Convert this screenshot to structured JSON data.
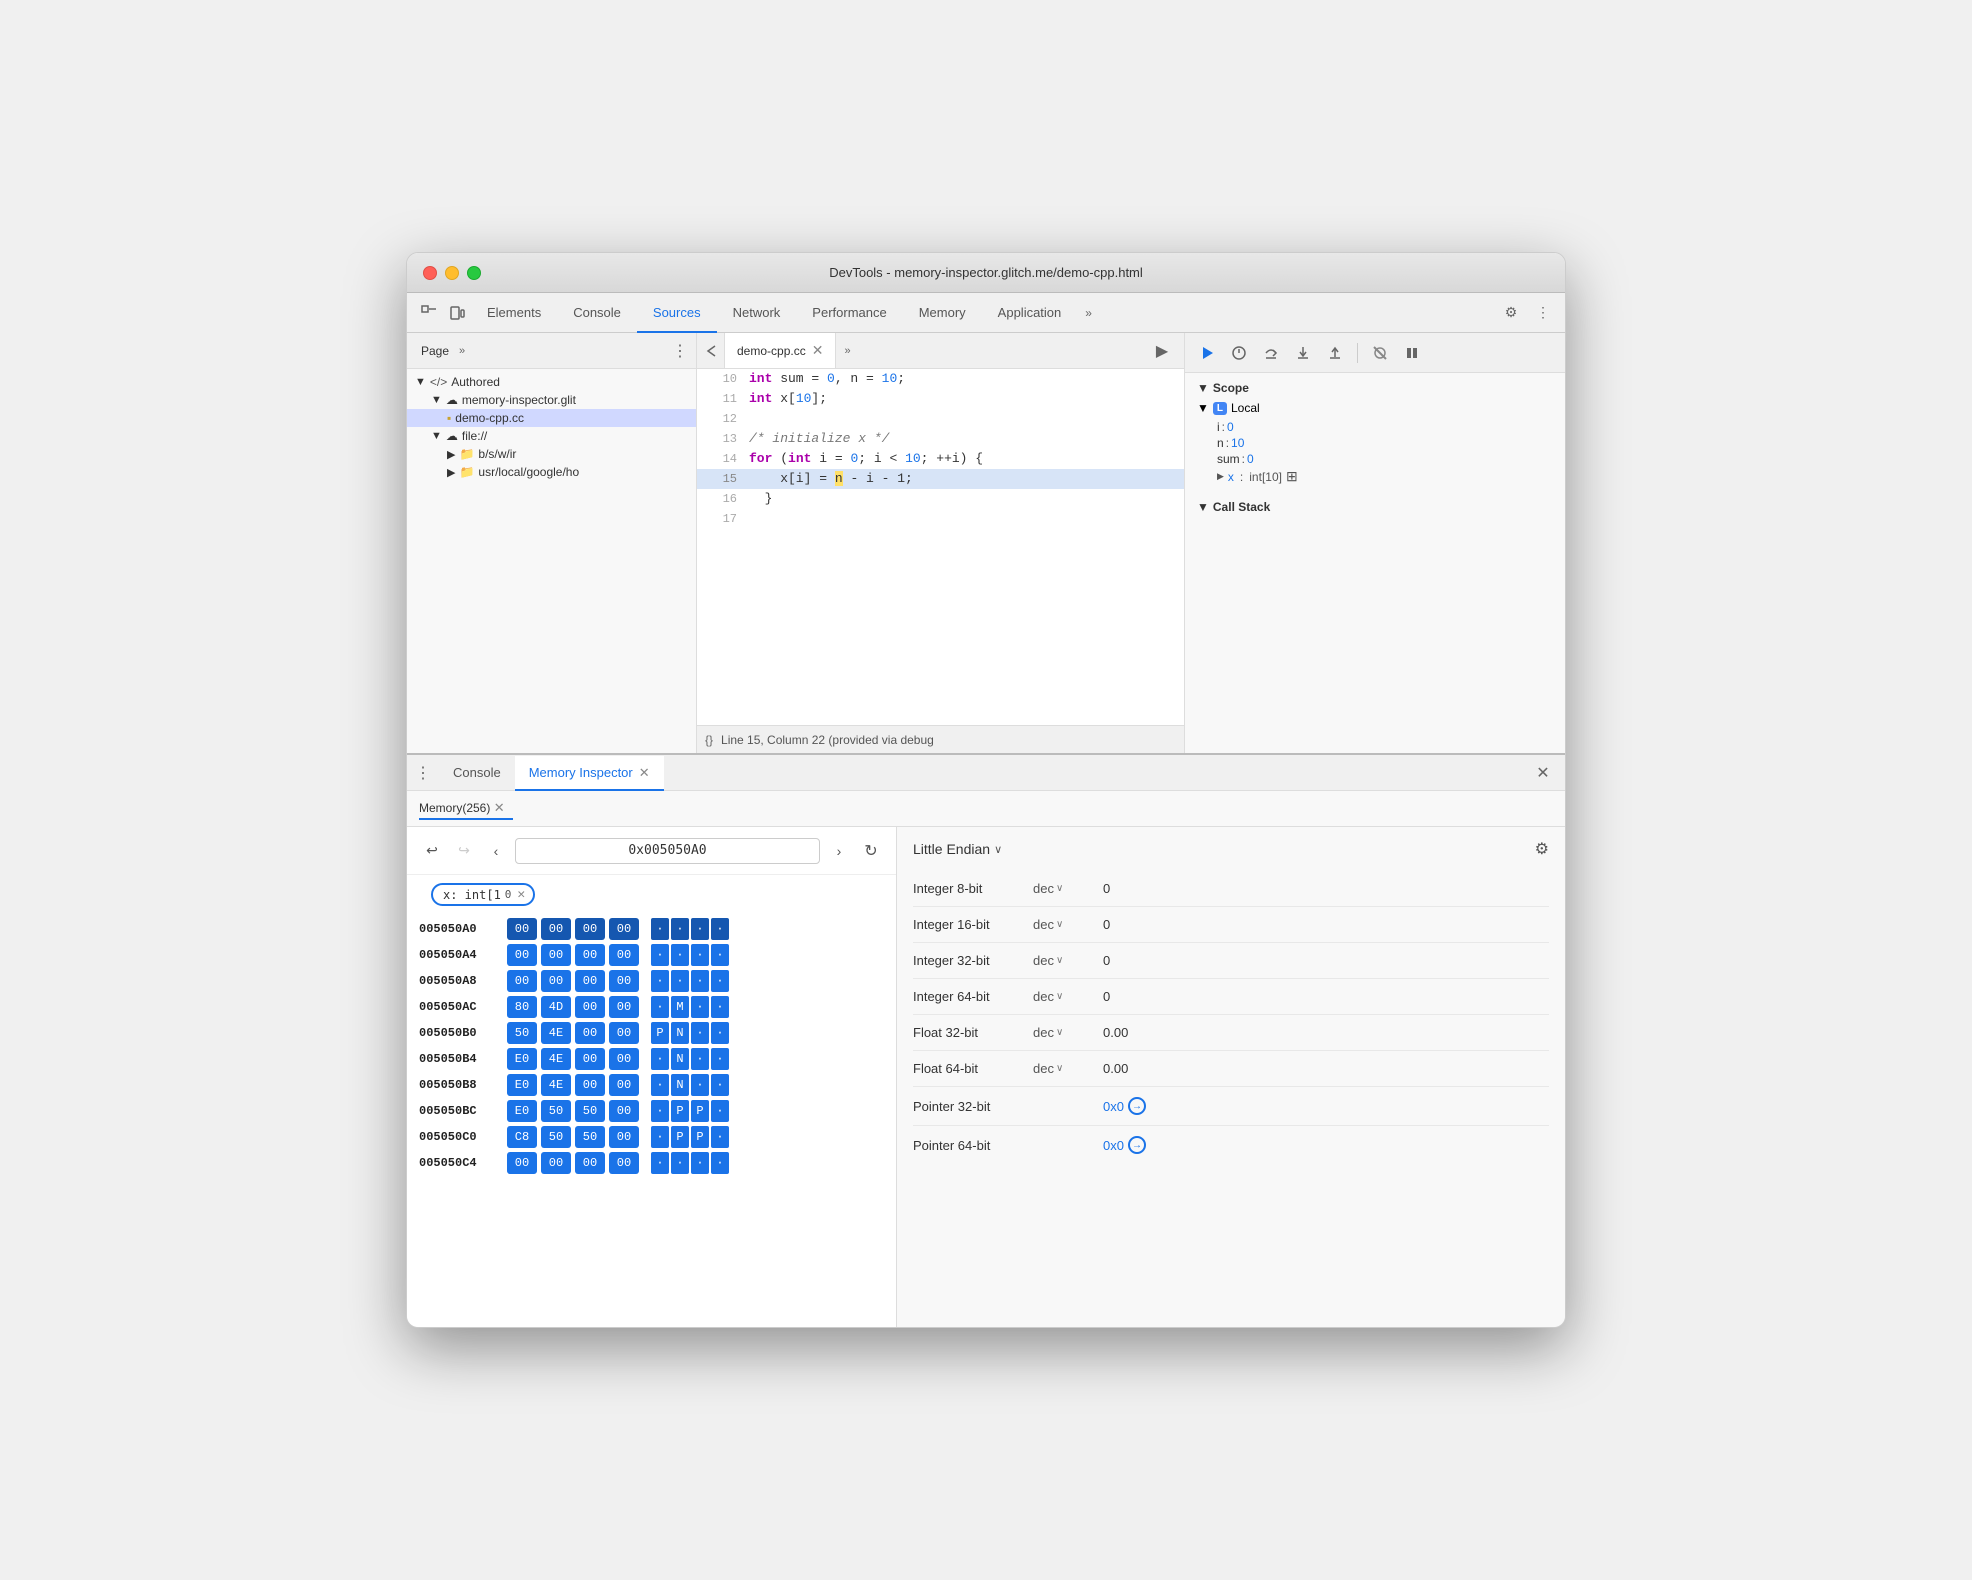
{
  "window": {
    "title": "DevTools - memory-inspector.glitch.me/demo-cpp.html"
  },
  "tabs": {
    "elements": "Elements",
    "console": "Console",
    "sources": "Sources",
    "network": "Network",
    "performance": "Performance",
    "memory": "Memory",
    "application": "Application",
    "more": "»"
  },
  "left_panel": {
    "tab": "Page",
    "more": "»",
    "tree": [
      {
        "label": "</> Authored",
        "indent": 0,
        "icon": "▶"
      },
      {
        "label": "memory-inspector.glit",
        "indent": 1,
        "icon": "☁",
        "expanded": true
      },
      {
        "label": "demo-cpp.cc",
        "indent": 2,
        "icon": "📄",
        "selected": true
      },
      {
        "label": "file://",
        "indent": 1,
        "icon": "☁",
        "expanded": true
      },
      {
        "label": "b/s/w/ir",
        "indent": 2,
        "icon": "📁",
        "has_arrow": true
      },
      {
        "label": "usr/local/google/ho",
        "indent": 2,
        "icon": "📁",
        "has_arrow": true
      }
    ]
  },
  "editor": {
    "tab_name": "demo-cpp.cc",
    "lines": [
      {
        "num": 10,
        "tokens": [
          {
            "type": "kw",
            "text": "int"
          },
          {
            "type": "normal",
            "text": " sum = "
          },
          {
            "type": "num",
            "text": "0"
          },
          {
            "type": "normal",
            "text": ", n = "
          },
          {
            "type": "num",
            "text": "10"
          },
          {
            "type": "normal",
            "text": ";"
          }
        ]
      },
      {
        "num": 11,
        "tokens": [
          {
            "type": "kw",
            "text": "int"
          },
          {
            "type": "normal",
            "text": " x["
          },
          {
            "type": "num",
            "text": "10"
          },
          {
            "type": "normal",
            "text": "];"
          }
        ]
      },
      {
        "num": 12,
        "tokens": []
      },
      {
        "num": 13,
        "tokens": [
          {
            "type": "comment",
            "text": "/* initialize x */"
          }
        ]
      },
      {
        "num": 14,
        "tokens": [
          {
            "type": "kw",
            "text": "for"
          },
          {
            "type": "normal",
            "text": " ("
          },
          {
            "type": "kw",
            "text": "int"
          },
          {
            "type": "normal",
            "text": " i = "
          },
          {
            "type": "num",
            "text": "0"
          },
          {
            "type": "normal",
            "text": "; i < "
          },
          {
            "type": "num",
            "text": "10"
          },
          {
            "type": "normal",
            "text": "; ++i) {"
          }
        ]
      },
      {
        "num": 15,
        "tokens": [
          {
            "type": "normal",
            "text": "    x[i] = "
          },
          {
            "type": "highlight_n",
            "text": "n"
          },
          {
            "type": "normal",
            "text": " - i - 1;"
          }
        ],
        "active": true
      },
      {
        "num": 16,
        "tokens": [
          {
            "type": "normal",
            "text": "  }"
          }
        ]
      },
      {
        "num": 17,
        "tokens": []
      }
    ],
    "status": "Line 15, Column 22 (provided via debug"
  },
  "debugger": {
    "scope_header": "▼ Scope",
    "local_header": "▼ Local",
    "vars": [
      {
        "name": "i",
        "colon": ":",
        "value": "0"
      },
      {
        "name": "n",
        "colon": ":",
        "value": "10"
      },
      {
        "name": "sum",
        "colon": ":",
        "value": "0"
      }
    ],
    "arr_var": {
      "label": "▶ x",
      "colon": ":",
      "type": "int[10]",
      "memory_icon": "⊞"
    },
    "callstack_header": "▼ Call Stack"
  },
  "bottom": {
    "console_tab": "Console",
    "memory_inspector_tab": "Memory Inspector",
    "close_btn": "✕"
  },
  "memory_subtab": {
    "label": "Memory(256)",
    "close": "✕"
  },
  "hex": {
    "nav_back": "↩",
    "nav_forward": "↪",
    "nav_prev": "‹",
    "nav_next": "›",
    "address": "0x005050A0",
    "refresh": "↻",
    "var_chip": "x: int[1",
    "rows": [
      {
        "addr": "005050A0",
        "bytes": [
          "00",
          "00",
          "00",
          "00"
        ],
        "ascii": [
          "·",
          "·",
          "·",
          "·"
        ],
        "bold": true
      },
      {
        "addr": "005050A4",
        "bytes": [
          "00",
          "00",
          "00",
          "00"
        ],
        "ascii": [
          "·",
          "·",
          "·",
          "·"
        ]
      },
      {
        "addr": "005050A8",
        "bytes": [
          "00",
          "00",
          "00",
          "00"
        ],
        "ascii": [
          "·",
          "·",
          "·",
          "·"
        ]
      },
      {
        "addr": "005050AC",
        "bytes": [
          "80",
          "4D",
          "00",
          "00"
        ],
        "ascii": [
          "·",
          "M",
          "·",
          "·"
        ]
      },
      {
        "addr": "005050B0",
        "bytes": [
          "50",
          "4E",
          "00",
          "00"
        ],
        "ascii": [
          "P",
          "N",
          "·",
          "·"
        ]
      },
      {
        "addr": "005050B4",
        "bytes": [
          "E0",
          "4E",
          "00",
          "00"
        ],
        "ascii": [
          "·",
          "N",
          "·",
          "·"
        ]
      },
      {
        "addr": "005050B8",
        "bytes": [
          "E0",
          "4E",
          "00",
          "00"
        ],
        "ascii": [
          "·",
          "N",
          "·",
          "·"
        ]
      },
      {
        "addr": "005050BC",
        "bytes": [
          "E0",
          "50",
          "50",
          "00"
        ],
        "ascii": [
          "·",
          "P",
          "P",
          "·"
        ]
      },
      {
        "addr": "005050C0",
        "bytes": [
          "C8",
          "50",
          "50",
          "00"
        ],
        "ascii": [
          "·",
          "P",
          "P",
          "·"
        ]
      },
      {
        "addr": "005050C4",
        "bytes": [
          "00",
          "00",
          "00",
          "00"
        ],
        "ascii": [
          "·",
          "·",
          "·",
          "·"
        ]
      }
    ]
  },
  "inspector": {
    "endian": "Little Endian",
    "rows": [
      {
        "label": "Integer 8-bit",
        "format": "dec",
        "value": "0"
      },
      {
        "label": "Integer 16-bit",
        "format": "dec",
        "value": "0"
      },
      {
        "label": "Integer 32-bit",
        "format": "dec",
        "value": "0"
      },
      {
        "label": "Integer 64-bit",
        "format": "dec",
        "value": "0"
      },
      {
        "label": "Float 32-bit",
        "format": "dec",
        "value": "0.00"
      },
      {
        "label": "Float 64-bit",
        "format": "dec",
        "value": "0.00"
      },
      {
        "label": "Pointer 32-bit",
        "format": null,
        "value": "0x0"
      },
      {
        "label": "Pointer 64-bit",
        "format": null,
        "value": "0x0"
      }
    ]
  }
}
